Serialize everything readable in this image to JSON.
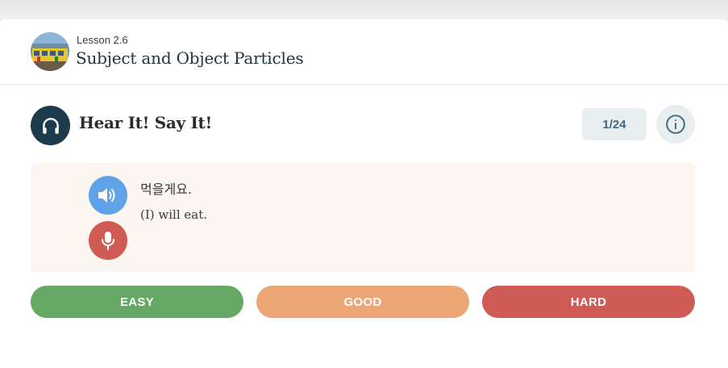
{
  "lesson": {
    "number": "Lesson 2.6",
    "title": "Subject and Object Particles",
    "thumbnail_icon": "lesson-photo-thumbnail"
  },
  "section": {
    "icon": "headphones-icon",
    "title": "Hear It! Say It!",
    "counter": "1/24",
    "info_icon": "info-icon"
  },
  "phrase": {
    "korean": "먹을게요.",
    "english": "(I) will eat.",
    "audio_icon": "speaker-icon",
    "record_icon": "microphone-icon"
  },
  "ratings": {
    "easy": "EASY",
    "good": "GOOD",
    "hard": "HARD"
  },
  "colors": {
    "easy": "#66a866",
    "good": "#eca574",
    "hard": "#cf5b56",
    "audio": "#5fa2e8",
    "record": "#d05a54",
    "headphones_bg": "#1c3c4d"
  }
}
